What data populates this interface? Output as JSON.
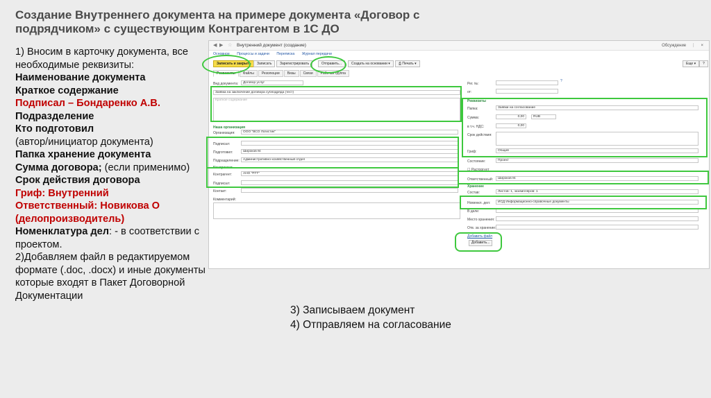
{
  "slide": {
    "title": "Создание Внутреннего документа на примере документа «Договор с подрядчиком» с существующим Контрагентом в 1С ДО",
    "instructions": {
      "intro": "1) Вносим в карточку документа, все необходимые реквизиты:",
      "name": "Наименование документа",
      "summary": "Краткое содержание",
      "signed": "Подписал – Бондаренко А.В.",
      "division": "Подразделение",
      "prepared": "Кто подготовил",
      "prepared_note": "(автор/инициатор документа)",
      "folder": "Папка хранение документа",
      "amount": "Сумма договора;",
      "amount_note": " (если применимо)",
      "term": "Срок действия договора",
      "stamp": "Гриф: Внутренний",
      "responsible": "Ответственный: Новикова О (делопроизводитель)",
      "nomenclature": "Номенклатура дел",
      "nomenclature_note": ": - в соответствии с проектом.",
      "step2": "2)Добавляем файл в редактируемом формате (.doc, .docx) и иные документы которые входят в Пакет Договорной Документации"
    },
    "step3": "3) Записываем документ",
    "step4": "4) Отправляем на согласование"
  },
  "window": {
    "title": "Внутренний документ (создание)",
    "top_right": [
      "Обсуждение",
      "×"
    ],
    "nav": [
      "Основное",
      "Процессы и задачи",
      "Переписка",
      "Журнал передачи"
    ],
    "toolbar": {
      "save_close": "Записать и закрыть",
      "save": "Записать",
      "register": "Зарегистрировать",
      "send": "Отправить...",
      "create_based": "Создать на основании",
      "print": "Печать",
      "more": "Еще",
      "help": "?"
    },
    "tabs": [
      "Реквизиты",
      "Файлы",
      "Резолюции",
      "Визы",
      "Связи",
      "Рабочая группа"
    ],
    "form": {
      "doc_type_label": "Вид документа:",
      "doc_type": "Договор услуг",
      "doc_title": "Заявка на заключение договора субподряда (тест)",
      "summary_placeholder": "Краткое содержание",
      "org_section": "Наша организация",
      "org_label": "Организация:",
      "org": "ООО \"ВСО Логистик\"",
      "signed_label": "Подписал:",
      "prepared_label": "Подготовил:",
      "prepared": "Широков М.",
      "division_label": "Подразделение:",
      "division": "Административно-хозяйственный отдел",
      "counterparty_section": "Контрагент",
      "counterparty_label": "Контрагент:",
      "counterparty": "АНО \"РГТ\"",
      "cp_signed_label": "Подписал:",
      "contact_label": "Контакт:",
      "comment_label": "Комментарий:",
      "reg_no_label": "Рег. №:",
      "from_label": "от:",
      "details_section": "Реквизиты",
      "folder_label": "Папка:",
      "folder": "Заявки на согласование",
      "sum_label": "Сумма:",
      "sum": "0,00",
      "currency": "RUB",
      "vat_label": "в т.ч. НДС:",
      "vat": "0,00",
      "term_label": "Срок действия:",
      "stamp_label": "Гриф:",
      "stamp": "Общий",
      "state_label": "Состояние:",
      "state": "Проект",
      "cancelled": "Расторгнут",
      "responsible_label": "Ответственный:",
      "responsible": "Широков М.",
      "storage_section": "Хранение",
      "composition_label": "Состав:",
      "composition": "Листов: 1, экземпляров: 1",
      "nomenclature_label": "Номенкл. дел:",
      "nomenclature": "ИСД Информационно-справочные документы",
      "in_case_label": "В деле:",
      "storage_place_label": "Место хранения:",
      "storage_resp_label": "Отв. за хранение:",
      "add_file_link": "Добавить файл",
      "add_button": "Добавить..."
    }
  }
}
